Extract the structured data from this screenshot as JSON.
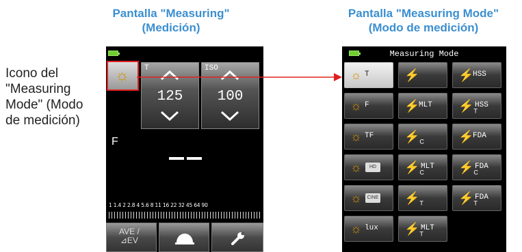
{
  "headers": {
    "left": "Pantalla \"Measuring\"\n(Medición)",
    "right": "Pantalla \"Measuring Mode\"\n(Modo de medición)"
  },
  "callout": "Icono del \"Measuring Mode\" (Modo de medición)",
  "measuring": {
    "t_label": "T",
    "t_value": "125",
    "iso_label": "ISO",
    "iso_value": "100",
    "mode_letter": "F",
    "scale": "1  1.4  2  2.8  4  5.6  8  11  16  22  32  45  64  90",
    "ave_label": "AVE /\n⊿EV"
  },
  "mode_screen": {
    "title": "Measuring Mode",
    "tiles": [
      {
        "icon": "sun",
        "color": "#d49400",
        "label": "T",
        "selected": true
      },
      {
        "icon": "flash",
        "color": "#3aa8ff",
        "label": ""
      },
      {
        "icon": "flash",
        "color": "#ff3da5",
        "label": "HSS"
      },
      {
        "icon": "sun",
        "color": "#d49400",
        "label": "F"
      },
      {
        "icon": "flash",
        "color": "#3aa8ff",
        "label": "MLT"
      },
      {
        "icon": "flash",
        "color": "#ff3da5",
        "label": "HSS",
        "sub": "T"
      },
      {
        "icon": "sun",
        "color": "#d49400",
        "label": "TF"
      },
      {
        "icon": "flash",
        "color": "#3aa8ff",
        "label": "",
        "sub": "C"
      },
      {
        "icon": "flash",
        "color": "#6ee030",
        "label": "FDA"
      },
      {
        "icon": "sun",
        "color": "#d49400",
        "label": "",
        "cam": "HD"
      },
      {
        "icon": "flash",
        "color": "#3aa8ff",
        "label": "MLT",
        "sub": "C"
      },
      {
        "icon": "flash",
        "color": "#6ee030",
        "label": "FDA",
        "sub": "C"
      },
      {
        "icon": "sun",
        "color": "#d49400",
        "label": "",
        "cam": "CINE"
      },
      {
        "icon": "flash",
        "color": "#3aa8ff",
        "label": "",
        "sub": "T"
      },
      {
        "icon": "flash",
        "color": "#6ee030",
        "label": "FDA",
        "sub": "T"
      },
      {
        "icon": "sun",
        "color": "#d49400",
        "label": "lux"
      },
      {
        "icon": "flash",
        "color": "#3aa8ff",
        "label": "MLT",
        "sub": "T"
      }
    ]
  }
}
